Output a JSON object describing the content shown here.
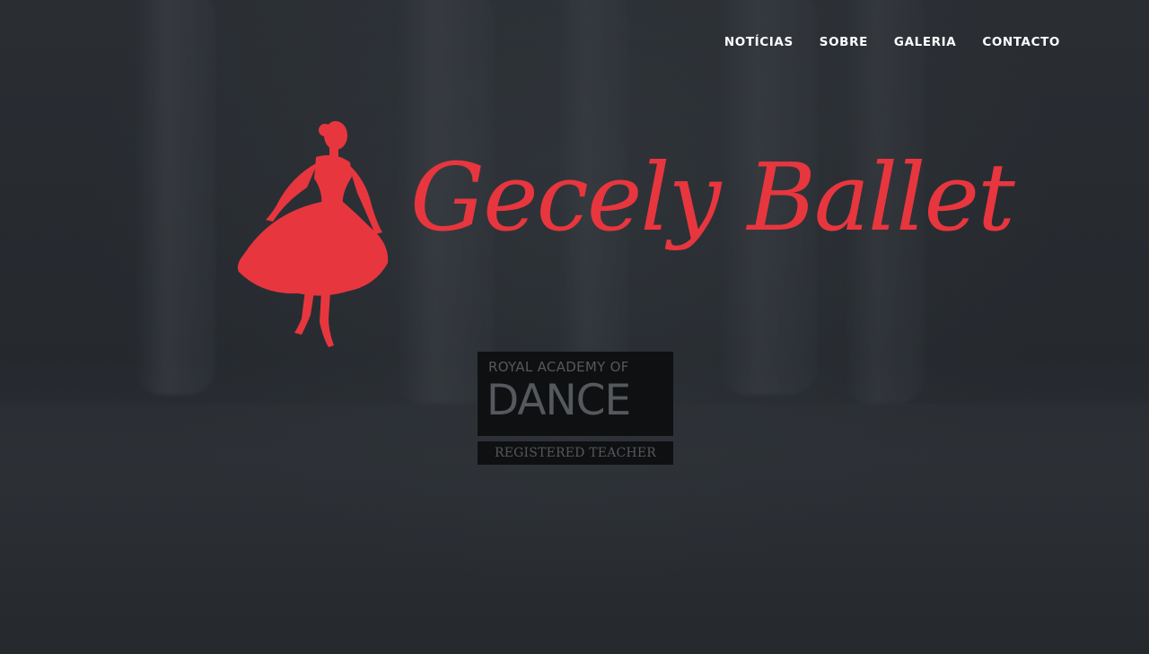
{
  "nav": {
    "items": [
      {
        "label": "NOTÍCIAS"
      },
      {
        "label": "SOBRE"
      },
      {
        "label": "GALERIA"
      },
      {
        "label": "CONTACTO"
      }
    ]
  },
  "logo": {
    "text": "Gecely Ballet",
    "color": "#e8363e"
  },
  "badge": {
    "line1": "ROYAL ACADEMY OF",
    "line2": "DANCE",
    "line3": "REGISTERED TEACHER"
  }
}
